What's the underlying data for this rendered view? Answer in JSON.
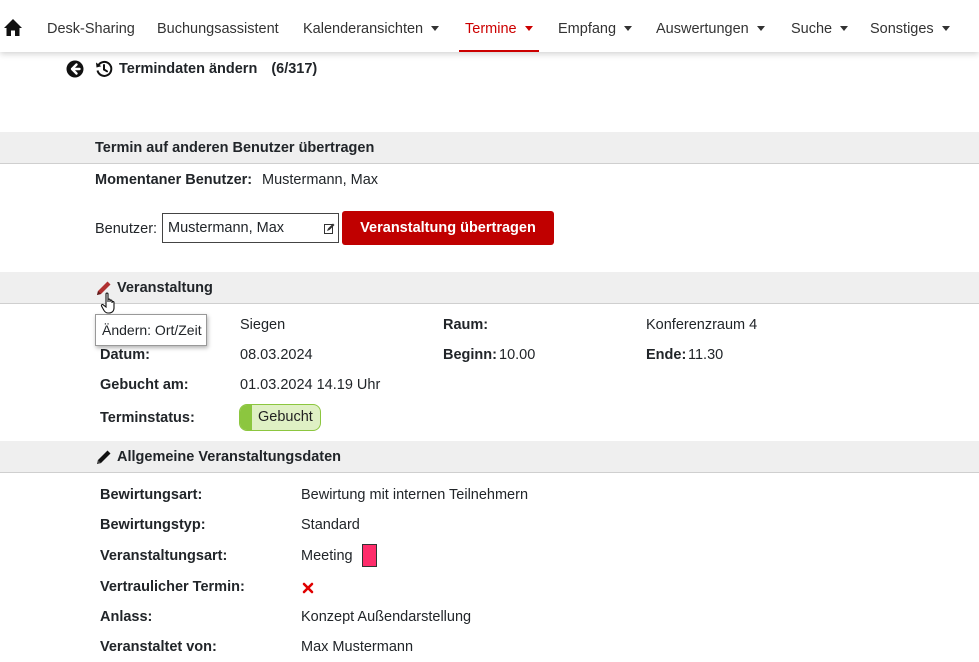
{
  "nav": {
    "items": [
      {
        "label": "Desk-Sharing",
        "dropdown": false
      },
      {
        "label": "Buchungsassistent",
        "dropdown": false
      },
      {
        "label": "Kalenderansichten",
        "dropdown": true
      },
      {
        "label": "Termine",
        "dropdown": true,
        "active": true
      },
      {
        "label": "Empfang",
        "dropdown": true
      },
      {
        "label": "Auswertungen",
        "dropdown": true
      },
      {
        "label": "Suche",
        "dropdown": true
      },
      {
        "label": "Sonstiges",
        "dropdown": true
      }
    ]
  },
  "header": {
    "title": "Termindaten ändern",
    "count": "(6/317)"
  },
  "transfer": {
    "section_title": "Termin auf anderen Benutzer übertragen",
    "current_user_label": "Momentaner Benutzer:",
    "current_user_value": "Mustermann, Max",
    "user_label": "Benutzer:",
    "user_value": "Mustermann, Max",
    "button_label": "Veranstaltung übertragen"
  },
  "event": {
    "section_title": "Veranstaltung",
    "tooltip": "Ändern: Ort/Zeit",
    "location_value": "Siegen",
    "room_label": "Raum:",
    "room_value": "Konferenzraum 4",
    "date_label": "Datum:",
    "date_value": "08.03.2024",
    "start_label": "Beginn:",
    "start_value": "10.00",
    "end_label": "Ende:",
    "end_value": "11.30",
    "booked_label": "Gebucht am:",
    "booked_value": "01.03.2024 14.19 Uhr",
    "status_label": "Terminstatus:",
    "status_value": "Gebucht"
  },
  "general": {
    "section_title": "Allgemeine Veranstaltungsdaten",
    "rows": [
      {
        "label": "Bewirtungsart:",
        "value": "Bewirtung mit internen Teilnehmern"
      },
      {
        "label": "Bewirtungstyp:",
        "value": "Standard"
      },
      {
        "label": "Veranstaltungsart:",
        "value": "Meeting"
      },
      {
        "label": "Vertraulicher Termin:",
        "value": ""
      },
      {
        "label": "Anlass:",
        "value": "Konzept Außendarstellung"
      },
      {
        "label": "Veranstaltet von:",
        "value": "Max Mustermann"
      }
    ],
    "event_type_color": "#ff2d6b"
  },
  "colors": {
    "accent": "#c00000",
    "status_green": "#8cc63f"
  }
}
